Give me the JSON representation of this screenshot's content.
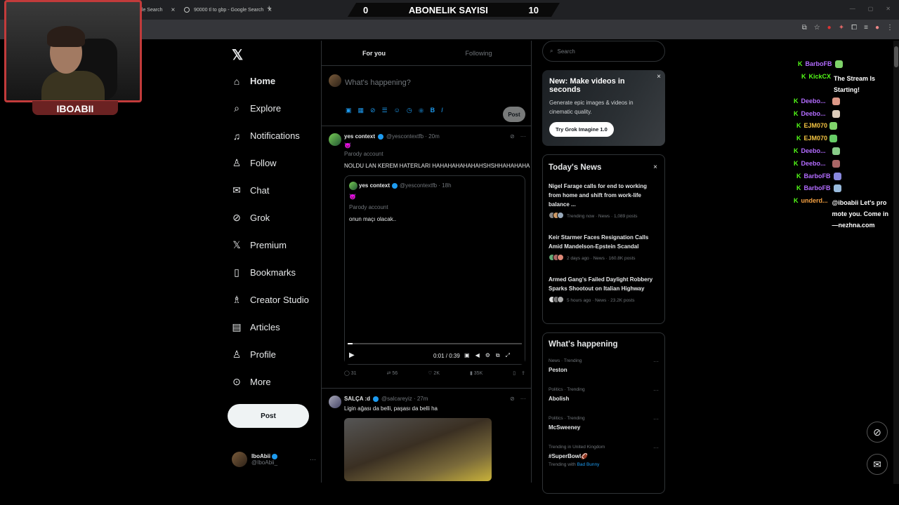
{
  "browser": {
    "tabs": [
      {
        "label": "gle Search"
      },
      {
        "label": "90000 tl to gbp - Google Search"
      }
    ],
    "new_tab": "+"
  },
  "overlay": {
    "score_left": "0",
    "score_title": "ABONELIK SAYISI",
    "score_right": "10",
    "streamer_name": "IBOABII"
  },
  "nav": {
    "logo": "𝕏",
    "items": [
      {
        "label": "Home",
        "icon": "home-icon"
      },
      {
        "label": "Explore",
        "icon": "search-icon"
      },
      {
        "label": "Notifications",
        "icon": "bell-icon"
      },
      {
        "label": "Follow",
        "icon": "follow-icon"
      },
      {
        "label": "Chat",
        "icon": "mail-icon"
      },
      {
        "label": "Grok",
        "icon": "grok-icon"
      },
      {
        "label": "Premium",
        "icon": "x-icon"
      },
      {
        "label": "Bookmarks",
        "icon": "bookmark-icon"
      },
      {
        "label": "Creator Studio",
        "icon": "creator-icon"
      },
      {
        "label": "Articles",
        "icon": "articles-icon"
      },
      {
        "label": "Profile",
        "icon": "person-icon"
      },
      {
        "label": "More",
        "icon": "more-icon"
      }
    ],
    "post_label": "Post",
    "profile_name": "IboAbii",
    "profile_handle": "@IboAbii_"
  },
  "feed": {
    "tab_for_you": "For you",
    "tab_following": "Following",
    "compose_placeholder": "What's happening?",
    "compose_post": "Post",
    "tweet1": {
      "name": "yes context",
      "handle": "@yescontextfb · 20m",
      "emoji": "😈",
      "label": "Parody account",
      "text": "NOLDU LAN KEREM HATERLARI HAHAHAHAHAHAHSHSHHAHAHAHA",
      "quote": {
        "name": "yes context",
        "handle": "@yescontextfb · 18h",
        "emoji": "😈",
        "label": "Parody account",
        "text": "onun maçı olacak..",
        "time": "0:01 / 0:39",
        "progress": 0.03
      },
      "replies": "31",
      "reposts": "56",
      "likes": "2K",
      "views": "35K"
    },
    "tweet2": {
      "name": "SALÇA :d",
      "handle": "@salcareyiz · 27m",
      "text": "Ligin ağası da belli, paşası da belli ha"
    }
  },
  "right": {
    "search_placeholder": "Search",
    "promo": {
      "title": "New: Make videos in seconds",
      "body": "Generate epic images & videos in cinematic quality.",
      "button": "Try Grok Imagine 1.0"
    },
    "news": {
      "title": "Today's News",
      "items": [
        {
          "title": "Nigel Farage calls for end to working from home and shift from work-life balance ...",
          "meta": "Trending now · News · 1,089 posts"
        },
        {
          "title": "Keir Starmer Faces Resignation Calls Amid Mandelson-Epstein Scandal",
          "meta": "2 days ago · News · 160.8K posts"
        },
        {
          "title": "Armed Gang's Failed Daylight Robbery Sparks Shootout on Italian Highway",
          "meta": "5 hours ago · News · 23.2K posts"
        }
      ]
    },
    "happening": {
      "title": "What's happening",
      "items": [
        {
          "context": "News · Trending",
          "name": "Peston"
        },
        {
          "context": "Politics · Trending",
          "name": "Abolish"
        },
        {
          "context": "Politics · Trending",
          "name": "McSweeney"
        },
        {
          "context": "Trending in United Kingdom",
          "name": "#SuperBowl🏈",
          "with_prefix": "Trending with",
          "with_link": "Bad Bunny"
        }
      ]
    }
  },
  "chat": [
    {
      "user": "BarboFB",
      "color": "#b36cff",
      "msg": ""
    },
    {
      "user": "KickCX",
      "color": "#53fc18",
      "msg": "The Stream Is Starting!"
    },
    {
      "user": "Deebo...",
      "color": "#b36cff",
      "msg": ""
    },
    {
      "user": "Deebo...",
      "color": "#b36cff",
      "msg": ""
    },
    {
      "user": "EJM070",
      "color": "#f5c542",
      "msg": ""
    },
    {
      "user": "EJM070",
      "color": "#f5c542",
      "msg": ""
    },
    {
      "user": "Deebo...",
      "color": "#b36cff",
      "msg": ""
    },
    {
      "user": "Deebo...",
      "color": "#b36cff",
      "msg": ""
    },
    {
      "user": "BarboFB",
      "color": "#b36cff",
      "msg": ""
    },
    {
      "user": "BarboFB",
      "color": "#b36cff",
      "msg": ""
    },
    {
      "user": "underd...",
      "color": "#f5a142",
      "msg": "@iboabii Let's promote you. Come in—nezhna.com"
    }
  ]
}
